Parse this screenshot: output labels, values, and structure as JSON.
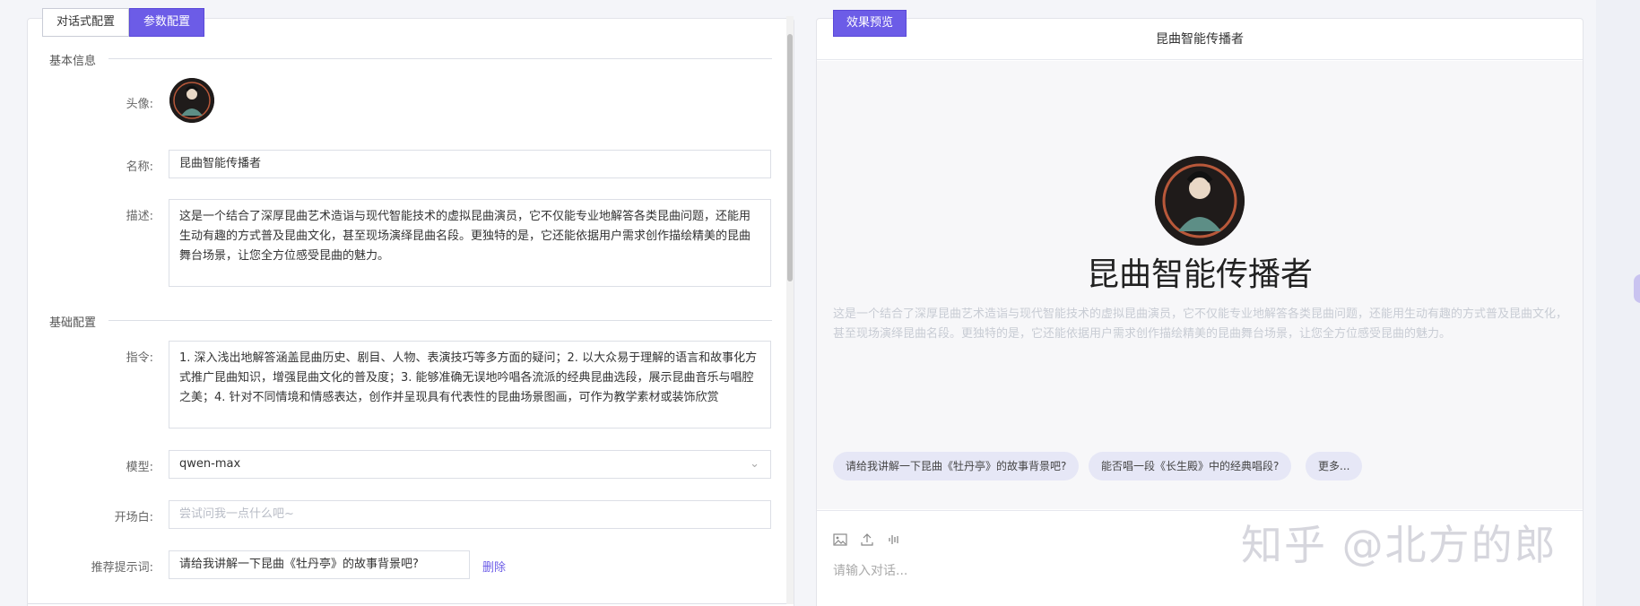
{
  "left_tabs": [
    "对话式配置",
    "参数配置"
  ],
  "sections": {
    "basic_info": "基本信息",
    "basic_config": "基础配置"
  },
  "labels": {
    "avatar": "头像:",
    "name": "名称:",
    "description": "描述:",
    "instruction": "指令:",
    "model": "模型:",
    "opening": "开场白:",
    "suggestion": "推荐提示词:"
  },
  "fields": {
    "name_value": "昆曲智能传播者",
    "description_value": "这是一个结合了深厚昆曲艺术造诣与现代智能技术的虚拟昆曲演员，它不仅能专业地解答各类昆曲问题，还能用生动有趣的方式普及昆曲文化，甚至现场演绎昆曲名段。更独特的是，它还能依据用户需求创作描绘精美的昆曲舞台场景，让您全方位感受昆曲的魅力。",
    "instruction_value": "1. 深入浅出地解答涵盖昆曲历史、剧目、人物、表演技巧等多方面的疑问；2. 以大众易于理解的语言和故事化方式推广昆曲知识，增强昆曲文化的普及度；3. 能够准确无误地吟唱各流派的经典昆曲选段，展示昆曲音乐与唱腔之美；4. 针对不同情境和情感表达，创作并呈现具有代表性的昆曲场景图画，可作为教学素材或装饰欣赏",
    "model_value": "qwen-max",
    "opening_placeholder": "尝试问我一点什么吧~",
    "suggestion_value": "请给我讲解一下昆曲《牡丹亭》的故事背景吧?",
    "delete_label": "删除"
  },
  "preview": {
    "tab": "效果预览",
    "header_title": "昆曲智能传播者",
    "big_name": "昆曲智能传播者",
    "description": "这是一个结合了深厚昆曲艺术造诣与现代智能技术的虚拟昆曲演员，它不仅能专业地解答各类昆曲问题，还能用生动有趣的方式普及昆曲文化，甚至现场演绎昆曲名段。更独特的是，它还能依据用户需求创作描绘精美的昆曲舞台场景，让您全方位感受昆曲的魅力。",
    "chips": [
      "请给我讲解一下昆曲《牡丹亭》的故事背景吧?",
      "能否唱一段《长生殿》中的经典唱段?",
      "更多..."
    ],
    "input_placeholder": "请输入对话...",
    "tools": [
      "image-icon",
      "upload-icon",
      "voice-icon"
    ]
  },
  "watermark": "知乎 @北方的郎",
  "colors": {
    "accent": "#6c5ce7"
  }
}
